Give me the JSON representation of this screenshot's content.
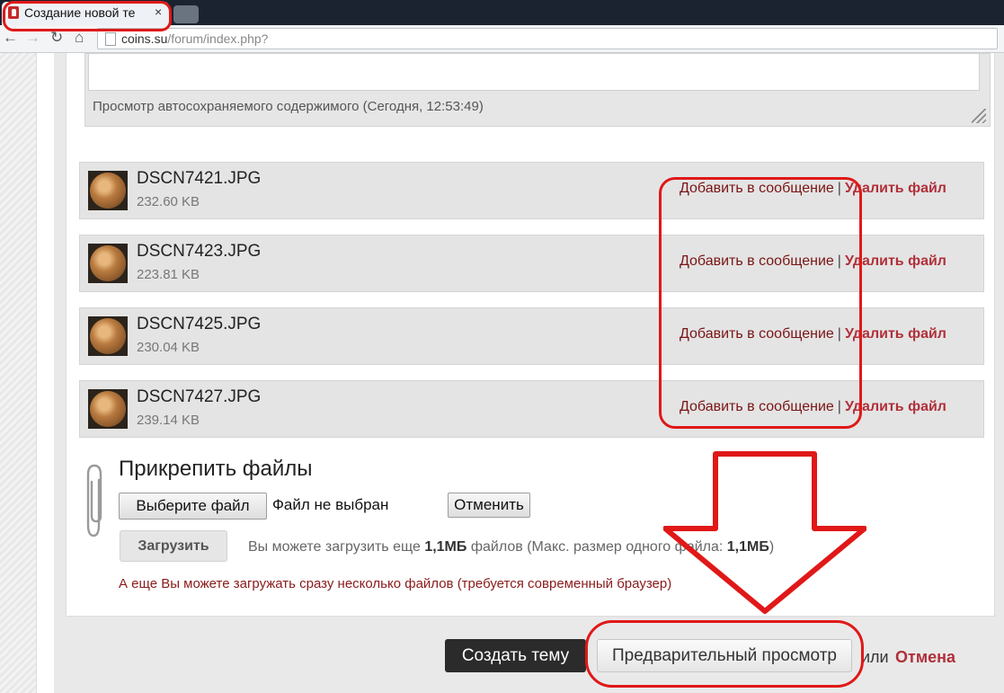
{
  "browser": {
    "tab_title": "Создание новой те",
    "close_glyph": "×",
    "url_host": "coins.su",
    "url_path": "/forum/index.php?"
  },
  "editor": {
    "autosave_text": "Просмотр автосохраняемого содержимого (Сегодня, 12:53:49)"
  },
  "attachments": [
    {
      "name": "DSCN7421.JPG",
      "size": "232.60 KB",
      "add_label": "Добавить в сообщение",
      "sep": "|",
      "delete_label": "Удалить файл"
    },
    {
      "name": "DSCN7423.JPG",
      "size": "223.81 KB",
      "add_label": "Добавить в сообщение",
      "sep": "|",
      "delete_label": "Удалить файл"
    },
    {
      "name": "DSCN7425.JPG",
      "size": "230.04 KB",
      "add_label": "Добавить в сообщение",
      "sep": "|",
      "delete_label": "Удалить файл"
    },
    {
      "name": "DSCN7427.JPG",
      "size": "239.14 KB",
      "add_label": "Добавить в сообщение",
      "sep": "|",
      "delete_label": "Удалить файл"
    }
  ],
  "upload": {
    "heading": "Прикрепить файлы",
    "choose_label": "Выберите файл",
    "no_file_text": "Файл не выбран",
    "cancel_label": "Отменить",
    "upload_label": "Загрузить",
    "info_prefix": "Вы можете загрузить еще",
    "info_amount": "1,1МБ",
    "info_middle": "файлов (Макс. размер одного файла:",
    "info_max": "1,1МБ",
    "info_suffix": ")",
    "multi_note": "А еще Вы можете загружать сразу несколько файлов (требуется современный браузер)"
  },
  "actions": {
    "create_label": "Создать тему",
    "preview_label": "Предварительный просмотр",
    "or_text": "или",
    "cancel_label": "Отмена"
  },
  "colors": {
    "annotation_red": "#e01818",
    "link_red": "#b0303a",
    "dark_button": "#2b2b2b"
  }
}
